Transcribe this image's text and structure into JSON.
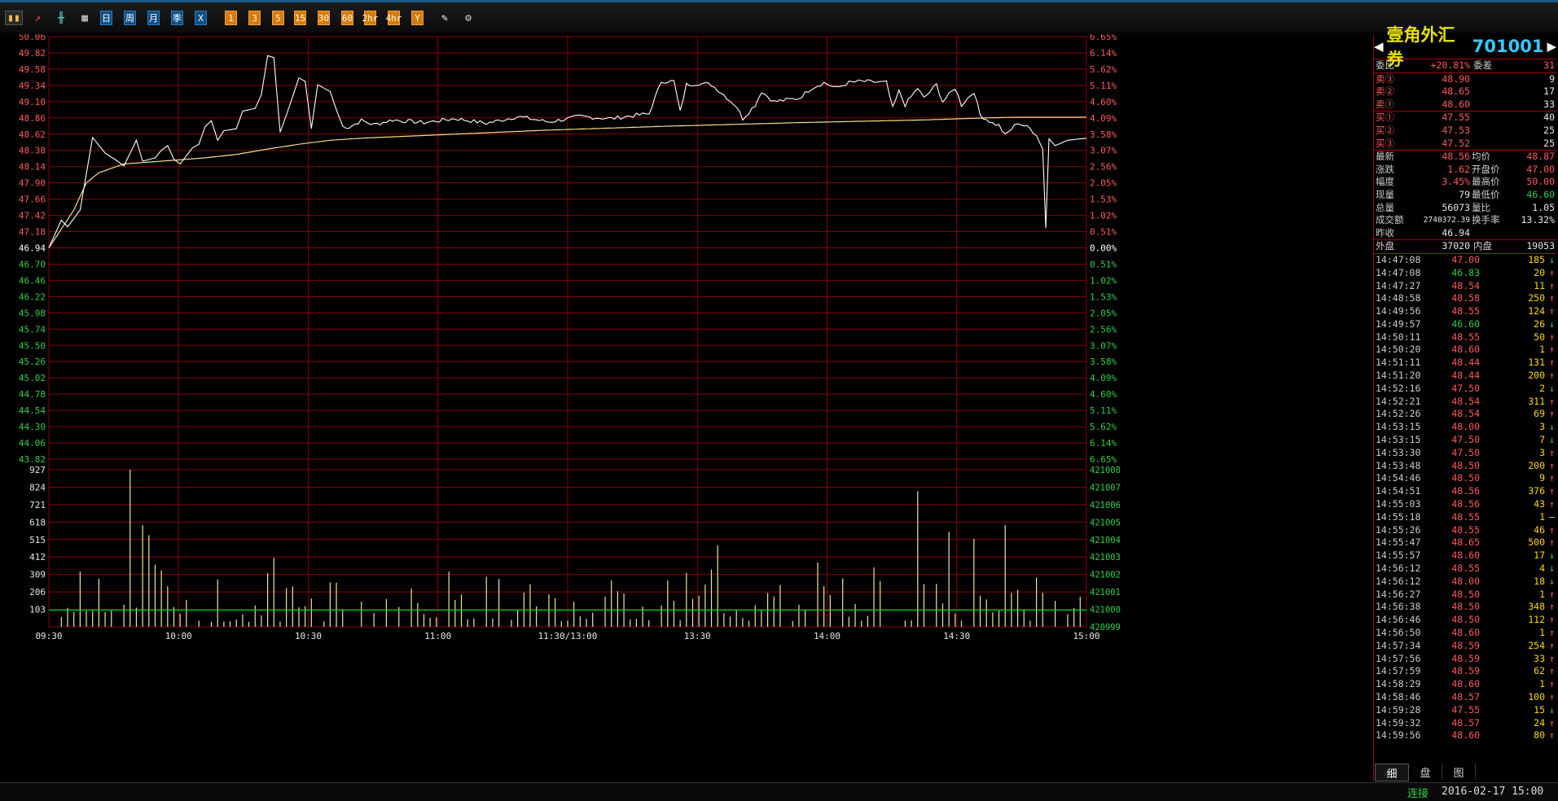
{
  "toolbar": {
    "buttons": [
      {
        "name": "bar-chart-icon",
        "text": "",
        "style": "icon sel"
      },
      {
        "name": "line-chart-icon",
        "text": "",
        "style": "icon"
      },
      {
        "name": "candlestick-icon",
        "text": "",
        "style": "icon"
      },
      {
        "name": "calendar-icon",
        "text": "",
        "style": "icon"
      },
      {
        "name": "period-day",
        "text": "日",
        "style": "blue"
      },
      {
        "name": "period-week",
        "text": "周",
        "style": "blue"
      },
      {
        "name": "period-month",
        "text": "月",
        "style": "blue"
      },
      {
        "name": "period-quarter",
        "text": "季",
        "style": "blue"
      },
      {
        "name": "period-x",
        "text": "X",
        "style": "blue"
      },
      {
        "name": "period-1",
        "text": "1",
        "style": "orange"
      },
      {
        "name": "period-3",
        "text": "3",
        "style": "orange"
      },
      {
        "name": "period-5",
        "text": "5",
        "style": "orange"
      },
      {
        "name": "period-15",
        "text": "15",
        "style": "orange"
      },
      {
        "name": "period-30",
        "text": "30",
        "style": "orange"
      },
      {
        "name": "period-60",
        "text": "60",
        "style": "orange"
      },
      {
        "name": "period-2hr",
        "text": "2hr",
        "style": "orange"
      },
      {
        "name": "period-4hr",
        "text": "4hr",
        "style": "orange"
      },
      {
        "name": "period-y",
        "text": "Y",
        "style": "orange"
      },
      {
        "name": "pencil-icon",
        "text": "",
        "style": "icon"
      },
      {
        "name": "gear-icon",
        "text": "",
        "style": "icon"
      }
    ]
  },
  "chart_data": {
    "type": "line",
    "time_labels": [
      "09:30",
      "10:00",
      "10:30",
      "11:00",
      "11:30/13:00",
      "13:30",
      "14:00",
      "14:30",
      "15:00"
    ],
    "price_axis_left": [
      "50.06",
      "49.82",
      "49.58",
      "49.34",
      "49.10",
      "48.86",
      "48.62",
      "48.38",
      "48.14",
      "47.90",
      "47.66",
      "47.42",
      "47.18",
      "46.94",
      "46.70",
      "46.46",
      "46.22",
      "45.98",
      "45.74",
      "45.50",
      "45.26",
      "45.02",
      "44.78",
      "44.54",
      "44.30",
      "44.06",
      "43.82"
    ],
    "price_axis_right": [
      "6.65%",
      "6.14%",
      "5.62%",
      "5.11%",
      "4.60%",
      "4.09%",
      "3.58%",
      "3.07%",
      "2.56%",
      "2.05%",
      "1.53%",
      "1.02%",
      "0.51%",
      "0.00%",
      "0.51%",
      "1.02%",
      "1.53%",
      "2.05%",
      "2.56%",
      "3.07%",
      "3.58%",
      "4.09%",
      "4.60%",
      "5.11%",
      "5.62%",
      "6.14%",
      "6.65%"
    ],
    "volume_axis_left": [
      "927",
      "824",
      "721",
      "618",
      "515",
      "412",
      "309",
      "206",
      "103"
    ],
    "volume_axis_right": [
      "421008",
      "421007",
      "421006",
      "421005",
      "421004",
      "421003",
      "421002",
      "421001",
      "421000",
      "420999"
    ],
    "ylim_price": [
      43.82,
      50.06
    ],
    "prev_close": 46.94,
    "ylim_volume": [
      0,
      927
    ],
    "colors": {
      "price_line": "#ffffff",
      "avg_line": "#f5e08a",
      "volume": "#e8e8a0",
      "grid": "#8b0000",
      "up": "#ff5a5a",
      "down": "#2fd04a",
      "neutral": "#ffffff",
      "baseline": "#2fb32f"
    },
    "price_keyframes": [
      [
        0,
        46.94
      ],
      [
        2,
        47.35
      ],
      [
        3,
        47.25
      ],
      [
        5,
        47.5
      ],
      [
        7,
        48.57
      ],
      [
        9,
        48.34
      ],
      [
        11,
        48.22
      ],
      [
        12,
        48.15
      ],
      [
        14,
        48.53
      ],
      [
        15,
        48.22
      ],
      [
        17,
        48.27
      ],
      [
        18,
        48.38
      ],
      [
        19,
        48.45
      ],
      [
        20,
        48.25
      ],
      [
        21,
        48.18
      ],
      [
        23,
        48.42
      ],
      [
        24,
        48.47
      ],
      [
        25,
        48.73
      ],
      [
        26,
        48.82
      ],
      [
        27,
        48.53
      ],
      [
        28,
        48.67
      ],
      [
        30,
        48.7
      ],
      [
        31,
        48.96
      ],
      [
        33,
        49.0
      ],
      [
        34,
        49.2
      ],
      [
        35,
        49.78
      ],
      [
        36,
        49.75
      ],
      [
        37,
        48.65
      ],
      [
        38,
        48.9
      ],
      [
        40,
        49.45
      ],
      [
        41,
        49.4
      ],
      [
        42,
        48.7
      ],
      [
        43,
        49.35
      ],
      [
        45,
        49.25
      ],
      [
        46,
        48.98
      ],
      [
        47,
        48.74
      ],
      [
        48,
        48.72
      ],
      [
        50,
        48.82
      ],
      [
        52,
        48.76
      ],
      [
        55,
        48.83
      ],
      [
        60,
        48.79
      ],
      [
        65,
        48.85
      ],
      [
        70,
        48.78
      ],
      [
        75,
        48.88
      ],
      [
        80,
        48.8
      ],
      [
        85,
        48.88
      ],
      [
        90,
        48.85
      ],
      [
        94,
        48.9
      ],
      [
        96,
        48.92
      ],
      [
        98,
        49.4
      ],
      [
        100,
        49.4
      ],
      [
        101,
        48.95
      ],
      [
        102,
        49.35
      ],
      [
        104,
        49.37
      ],
      [
        106,
        49.35
      ],
      [
        108,
        49.2
      ],
      [
        110,
        49.03
      ],
      [
        111,
        48.85
      ],
      [
        113,
        49.05
      ],
      [
        114,
        49.25
      ],
      [
        116,
        49.1
      ],
      [
        120,
        49.15
      ],
      [
        122,
        49.3
      ],
      [
        124,
        49.38
      ],
      [
        126,
        49.3
      ],
      [
        128,
        49.38
      ],
      [
        130,
        49.4
      ],
      [
        134,
        49.38
      ],
      [
        135,
        49.0
      ],
      [
        136,
        49.25
      ],
      [
        137,
        49.05
      ],
      [
        139,
        49.3
      ],
      [
        140,
        49.15
      ],
      [
        142,
        49.35
      ],
      [
        143,
        49.1
      ],
      [
        145,
        49.3
      ],
      [
        146,
        49.05
      ],
      [
        148,
        49.25
      ],
      [
        149,
        48.9
      ],
      [
        151,
        48.78
      ],
      [
        152,
        48.75
      ],
      [
        153,
        48.6
      ],
      [
        155,
        48.79
      ],
      [
        157,
        48.7
      ],
      [
        158,
        48.6
      ],
      [
        159,
        48.4
      ],
      [
        159.6,
        47.0
      ],
      [
        160,
        48.55
      ],
      [
        161,
        48.45
      ],
      [
        163,
        48.53
      ],
      [
        166,
        48.56
      ]
    ],
    "avg_keyframes": [
      [
        0,
        46.94
      ],
      [
        4,
        47.5
      ],
      [
        6,
        47.9
      ],
      [
        8,
        48.05
      ],
      [
        12,
        48.18
      ],
      [
        18,
        48.22
      ],
      [
        25,
        48.27
      ],
      [
        30,
        48.32
      ],
      [
        35,
        48.4
      ],
      [
        40,
        48.47
      ],
      [
        45,
        48.53
      ],
      [
        50,
        48.56
      ],
      [
        60,
        48.6
      ],
      [
        70,
        48.64
      ],
      [
        80,
        48.68
      ],
      [
        100,
        48.74
      ],
      [
        120,
        48.79
      ],
      [
        140,
        48.83
      ],
      [
        150,
        48.86
      ],
      [
        155,
        48.87
      ],
      [
        160,
        48.87
      ],
      [
        166,
        48.87
      ]
    ],
    "volume_spikes": [
      [
        13,
        927
      ],
      [
        15,
        600
      ],
      [
        16,
        540
      ],
      [
        107,
        480
      ],
      [
        139,
        800
      ],
      [
        144,
        560
      ],
      [
        148,
        520
      ],
      [
        153,
        600
      ]
    ]
  },
  "sidebar": {
    "title_name": "壹角外汇券",
    "title_code": "701001",
    "weibi": {
      "label": "委比",
      "value": "+20.81%",
      "label2": "委差",
      "value2": "31"
    },
    "asks": [
      {
        "label": "卖③",
        "price": "48.90",
        "vol": "9"
      },
      {
        "label": "卖②",
        "price": "48.65",
        "vol": "17"
      },
      {
        "label": "卖①",
        "price": "48.60",
        "vol": "33"
      }
    ],
    "bids": [
      {
        "label": "买①",
        "price": "47.55",
        "vol": "40"
      },
      {
        "label": "买②",
        "price": "47.53",
        "vol": "25"
      },
      {
        "label": "买③",
        "price": "47.52",
        "vol": "25"
      }
    ],
    "stats": [
      {
        "l1": "最新",
        "v1": "48.56",
        "c1": "red",
        "l2": "均价",
        "v2": "48.87",
        "c2": "red"
      },
      {
        "l1": "涨跌",
        "v1": "1.62",
        "c1": "red",
        "l2": "开盘价",
        "v2": "47.00",
        "c2": "red"
      },
      {
        "l1": "幅度",
        "v1": "3.45%",
        "c1": "red",
        "l2": "最高价",
        "v2": "50.00",
        "c2": "red"
      },
      {
        "l1": "现量",
        "v1": "79",
        "c1": "wht",
        "l2": "最低价",
        "v2": "46.60",
        "c2": "grn"
      },
      {
        "l1": "总量",
        "v1": "56073",
        "c1": "wht",
        "l2": "量比",
        "v2": "1.05",
        "c2": "wht"
      },
      {
        "l1": "成交额",
        "v1": "2740372.39",
        "c1": "wht",
        "l2": "换手率",
        "v2": "13.32%",
        "c2": "wht"
      },
      {
        "l1": "昨收",
        "v1": "46.94",
        "c1": "wht",
        "l2": "",
        "v2": "",
        "c2": "wht"
      }
    ],
    "waipan": {
      "label": "外盘",
      "value": "37020",
      "label2": "内盘",
      "value2": "19053"
    },
    "ticks": [
      [
        "14:47:08",
        "47.00",
        "185",
        "↓",
        "red"
      ],
      [
        "14:47:08",
        "46.83",
        "20",
        "↑",
        "grn"
      ],
      [
        "14:47:27",
        "48.54",
        "11",
        "↑",
        "red"
      ],
      [
        "14:48:58",
        "48.58",
        "250",
        "↑",
        "red"
      ],
      [
        "14:49:56",
        "48.55",
        "124",
        "↑",
        "red"
      ],
      [
        "14:49:57",
        "46.60",
        "26",
        "↓",
        "grn"
      ],
      [
        "14:50:11",
        "48.55",
        "50",
        "↑",
        "red"
      ],
      [
        "14:50:20",
        "48.60",
        "1",
        "↑",
        "red"
      ],
      [
        "14:51:11",
        "48.44",
        "131",
        "↑",
        "red"
      ],
      [
        "14:51:20",
        "48.44",
        "200",
        "↑",
        "red"
      ],
      [
        "14:52:16",
        "47.50",
        "2",
        "↓",
        "red"
      ],
      [
        "14:52:21",
        "48.54",
        "311",
        "↑",
        "red"
      ],
      [
        "14:52:26",
        "48.54",
        "69",
        "↑",
        "red"
      ],
      [
        "14:53:15",
        "48.00",
        "3",
        "↓",
        "red"
      ],
      [
        "14:53:15",
        "47.50",
        "7",
        "↓",
        "red"
      ],
      [
        "14:53:30",
        "47.50",
        "3",
        "↑",
        "red"
      ],
      [
        "14:53:48",
        "48.50",
        "200",
        "↑",
        "red"
      ],
      [
        "14:54:46",
        "48.50",
        "9",
        "↑",
        "red"
      ],
      [
        "14:54:51",
        "48.56",
        "376",
        "↑",
        "red"
      ],
      [
        "14:55:03",
        "48.56",
        "43",
        "↑",
        "red"
      ],
      [
        "14:55:18",
        "48.55",
        "1",
        "—",
        "red"
      ],
      [
        "14:55:26",
        "48.55",
        "46",
        "↑",
        "red"
      ],
      [
        "14:55:47",
        "48.65",
        "500",
        "↑",
        "red"
      ],
      [
        "14:55:57",
        "48.60",
        "17",
        "↓",
        "red"
      ],
      [
        "14:56:12",
        "48.55",
        "4",
        "↓",
        "red"
      ],
      [
        "14:56:12",
        "48.00",
        "18",
        "↓",
        "red"
      ],
      [
        "14:56:27",
        "48.50",
        "1",
        "↑",
        "red"
      ],
      [
        "14:56:38",
        "48.50",
        "348",
        "↑",
        "red"
      ],
      [
        "14:56:46",
        "48.50",
        "112",
        "↑",
        "red"
      ],
      [
        "14:56:50",
        "48.60",
        "1",
        "↑",
        "red"
      ],
      [
        "14:57:34",
        "48.59",
        "254",
        "↑",
        "red"
      ],
      [
        "14:57:56",
        "48.59",
        "33",
        "↑",
        "red"
      ],
      [
        "14:57:59",
        "48.59",
        "62",
        "↑",
        "red"
      ],
      [
        "14:58:29",
        "48.60",
        "1",
        "↑",
        "red"
      ],
      [
        "14:58:46",
        "48.57",
        "100",
        "↑",
        "red"
      ],
      [
        "14:59:28",
        "47.55",
        "15",
        "↓",
        "red"
      ],
      [
        "14:59:32",
        "48.57",
        "24",
        "↑",
        "red"
      ],
      [
        "14:59:56",
        "48.60",
        "80",
        "↑",
        "red"
      ]
    ],
    "tabs": [
      "细",
      "盘",
      "图"
    ]
  },
  "status": {
    "connection": "连接",
    "datetime": "2016-02-17 15:00"
  }
}
